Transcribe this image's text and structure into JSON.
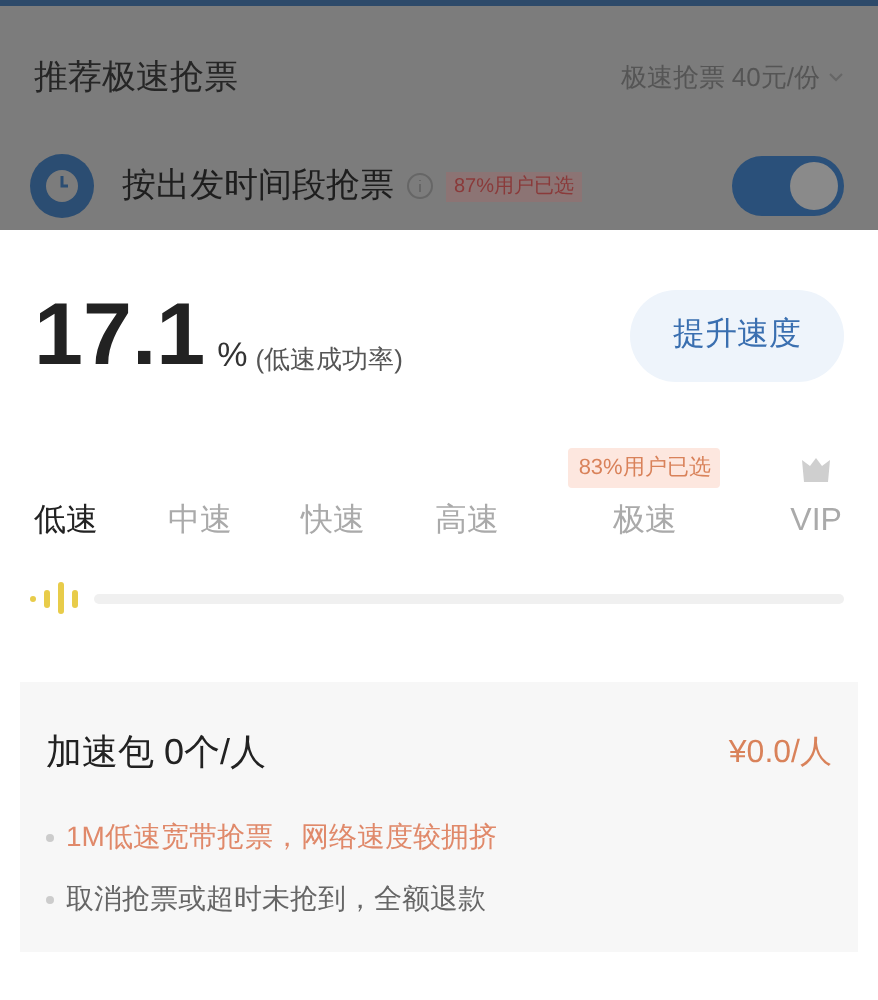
{
  "background": {
    "title": "推荐极速抢票",
    "price_link": "极速抢票 40元/份",
    "option": {
      "label": "按出发时间段抢票",
      "badge": "87%用户已选",
      "on": true
    }
  },
  "rate": {
    "value": "17.1",
    "unit": "%",
    "caption": "(低速成功率)"
  },
  "boost_button": "提升速度",
  "speeds": [
    {
      "label": "低速",
      "selected": true,
      "kind": "speed"
    },
    {
      "label": "中速",
      "selected": false,
      "kind": "speed"
    },
    {
      "label": "快速",
      "selected": false,
      "kind": "speed"
    },
    {
      "label": "高速",
      "selected": false,
      "kind": "speed"
    },
    {
      "label": "极速",
      "selected": false,
      "kind": "speed",
      "badge": "83%用户已选"
    },
    {
      "label": "VIP",
      "selected": false,
      "kind": "vip"
    }
  ],
  "package": {
    "title": "加速包 0个/人",
    "price": "¥0.0/人",
    "notes": [
      {
        "text": "1M低速宽带抢票，网络速度较拥挤",
        "color": "#e0896a"
      },
      {
        "text": "取消抢票或超时未抢到，全额退款",
        "color": "#666666"
      }
    ]
  }
}
